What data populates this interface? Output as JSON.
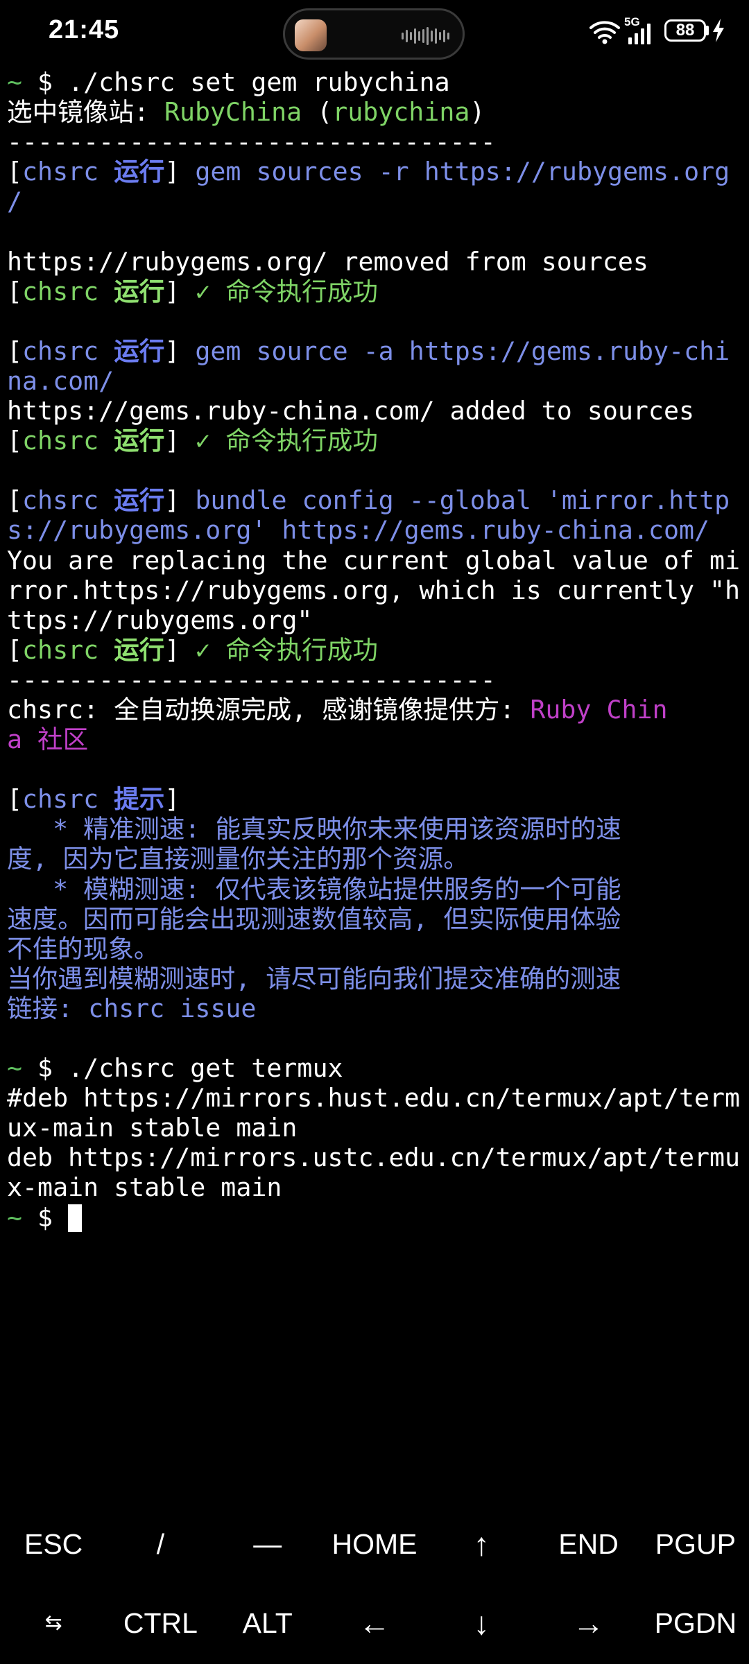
{
  "status_bar": {
    "time": "21:45",
    "network": "5G",
    "battery": "88",
    "icons": [
      "wifi-icon",
      "signal-icon",
      "battery-icon",
      "charging-icon"
    ]
  },
  "colors": {
    "background": "#000000",
    "prompt": "#5fbf5f",
    "success": "#7fd466",
    "info": "#7d8fe8",
    "provider": "#c040c8"
  },
  "terminal": {
    "lines": [
      [
        {
          "t": "~ ",
          "c": "prompt-tilde"
        },
        {
          "t": "$ ./chsrc set gem rubychina",
          "c": "cmd"
        }
      ],
      [
        {
          "t": "选中镜像站: ",
          "c": "white"
        },
        {
          "t": "RubyChina",
          "c": "green"
        },
        {
          "t": " (",
          "c": "white"
        },
        {
          "t": "rubychina",
          "c": "green"
        },
        {
          "t": ")",
          "c": "white"
        }
      ],
      [
        {
          "t": "--------------------------------",
          "c": "white"
        }
      ],
      [
        {
          "t": "[",
          "c": "white"
        },
        {
          "t": "chsrc ",
          "c": "blue"
        },
        {
          "t": "运行",
          "c": "blue-b"
        },
        {
          "t": "] ",
          "c": "white"
        },
        {
          "t": "gem sources -r https://rubygems.org",
          "c": "blue"
        }
      ],
      [
        {
          "t": "/",
          "c": "blue"
        }
      ],
      [
        {
          "t": "",
          "c": "white"
        }
      ],
      [
        {
          "t": "https://rubygems.org/ removed from sources",
          "c": "white"
        }
      ],
      [
        {
          "t": "[",
          "c": "white"
        },
        {
          "t": "chsrc ",
          "c": "green"
        },
        {
          "t": "运行",
          "c": "green-b"
        },
        {
          "t": "] ",
          "c": "white"
        },
        {
          "t": "✓ 命令执行成功",
          "c": "green"
        }
      ],
      [
        {
          "t": "",
          "c": "white"
        }
      ],
      [
        {
          "t": "[",
          "c": "white"
        },
        {
          "t": "chsrc ",
          "c": "blue"
        },
        {
          "t": "运行",
          "c": "blue-b"
        },
        {
          "t": "] ",
          "c": "white"
        },
        {
          "t": "gem source -a https://gems.ruby-chi",
          "c": "blue"
        }
      ],
      [
        {
          "t": "na.com/",
          "c": "blue"
        }
      ],
      [
        {
          "t": "https://gems.ruby-china.com/ added to sources",
          "c": "white"
        }
      ],
      [
        {
          "t": "[",
          "c": "white"
        },
        {
          "t": "chsrc ",
          "c": "green"
        },
        {
          "t": "运行",
          "c": "green-b"
        },
        {
          "t": "] ",
          "c": "white"
        },
        {
          "t": "✓ 命令执行成功",
          "c": "green"
        }
      ],
      [
        {
          "t": "",
          "c": "white"
        }
      ],
      [
        {
          "t": "[",
          "c": "white"
        },
        {
          "t": "chsrc ",
          "c": "blue"
        },
        {
          "t": "运行",
          "c": "blue-b"
        },
        {
          "t": "] ",
          "c": "white"
        },
        {
          "t": "bundle config --global 'mirror.http",
          "c": "blue"
        }
      ],
      [
        {
          "t": "s://rubygems.org' https://gems.ruby-china.com/",
          "c": "blue"
        }
      ],
      [
        {
          "t": "You are replacing the current global value of mi",
          "c": "white"
        }
      ],
      [
        {
          "t": "rror.https://rubygems.org, which is currently \"h",
          "c": "white"
        }
      ],
      [
        {
          "t": "ttps://rubygems.org\"",
          "c": "white"
        }
      ],
      [
        {
          "t": "[",
          "c": "white"
        },
        {
          "t": "chsrc ",
          "c": "green"
        },
        {
          "t": "运行",
          "c": "green-b"
        },
        {
          "t": "] ",
          "c": "white"
        },
        {
          "t": "✓ 命令执行成功",
          "c": "green"
        }
      ],
      [
        {
          "t": "--------------------------------",
          "c": "white"
        }
      ],
      [
        {
          "t": "chsrc: 全自动换源完成, 感谢镜像提供方: ",
          "c": "white"
        },
        {
          "t": "Ruby Chin",
          "c": "purple"
        }
      ],
      [
        {
          "t": "a 社区",
          "c": "purple"
        }
      ],
      [
        {
          "t": "",
          "c": "white"
        }
      ],
      [
        {
          "t": "[",
          "c": "white"
        },
        {
          "t": "chsrc ",
          "c": "blue"
        },
        {
          "t": "提示",
          "c": "blue-b"
        },
        {
          "t": "]",
          "c": "white"
        }
      ],
      [
        {
          "t": "   * 精准测速: 能真实反映你未来使用该资源时的速",
          "c": "blue"
        }
      ],
      [
        {
          "t": "度, 因为它直接测量你关注的那个资源。",
          "c": "blue"
        }
      ],
      [
        {
          "t": "   * 模糊测速: 仅代表该镜像站提供服务的一个可能",
          "c": "blue"
        }
      ],
      [
        {
          "t": "速度。因而可能会出现测速数值较高, 但实际使用体验",
          "c": "blue"
        }
      ],
      [
        {
          "t": "不佳的现象。",
          "c": "blue"
        }
      ],
      [
        {
          "t": "当你遇到模糊测速时, 请尽可能向我们提交准确的测速",
          "c": "blue"
        }
      ],
      [
        {
          "t": "链接: chsrc issue",
          "c": "blue"
        }
      ],
      [
        {
          "t": "",
          "c": "white"
        }
      ],
      [
        {
          "t": "~ ",
          "c": "prompt-tilde"
        },
        {
          "t": "$ ./chsrc get termux",
          "c": "cmd"
        }
      ],
      [
        {
          "t": "#deb https://mirrors.hust.edu.cn/termux/apt/term",
          "c": "white"
        }
      ],
      [
        {
          "t": "ux-main stable main",
          "c": "white"
        }
      ],
      [
        {
          "t": "deb https://mirrors.ustc.edu.cn/termux/apt/termu",
          "c": "white"
        }
      ],
      [
        {
          "t": "x-main stable main",
          "c": "white"
        }
      ],
      [
        {
          "t": "~ ",
          "c": "prompt-tilde"
        },
        {
          "t": "$ ",
          "c": "cmd"
        }
      ]
    ]
  },
  "extra_keys": {
    "row1": [
      "ESC",
      "/",
      "—",
      "HOME",
      "↑",
      "END",
      "PGUP"
    ],
    "row2": [
      "⇆",
      "CTRL",
      "ALT",
      "←",
      "↓",
      "→",
      "PGDN"
    ],
    "row1_names": [
      "esc-key",
      "slash-key",
      "dash-key",
      "home-key",
      "up-arrow-key",
      "end-key",
      "pgup-key"
    ],
    "row2_names": [
      "tab-key",
      "ctrl-key",
      "alt-key",
      "left-arrow-key",
      "down-arrow-key",
      "right-arrow-key",
      "pgdn-key"
    ]
  }
}
